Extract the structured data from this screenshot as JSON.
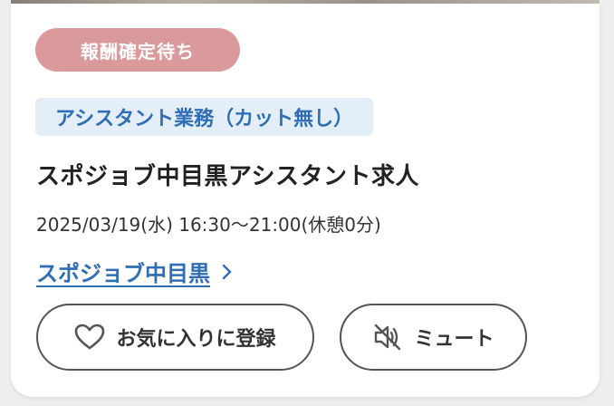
{
  "card": {
    "status_badge": "報酬確定待ち",
    "category_tag": "アシスタント業務（カット無し）",
    "job_title": "スポジョブ中目黒アシスタント求人",
    "schedule": "2025/03/19(水) 16:30〜21:00(休憩0分)",
    "shop_link": "スポジョブ中目黒",
    "favorite_button": "お気に入りに登録",
    "mute_button": "ミュート"
  },
  "colors": {
    "badge_bg": "#da9a9c",
    "tag_bg": "#e3eef8",
    "link": "#2f6db4",
    "text": "#222222"
  },
  "icons": {
    "link": "chevron-right-icon",
    "favorite": "heart-outline-icon",
    "mute": "speaker-muted-icon"
  }
}
